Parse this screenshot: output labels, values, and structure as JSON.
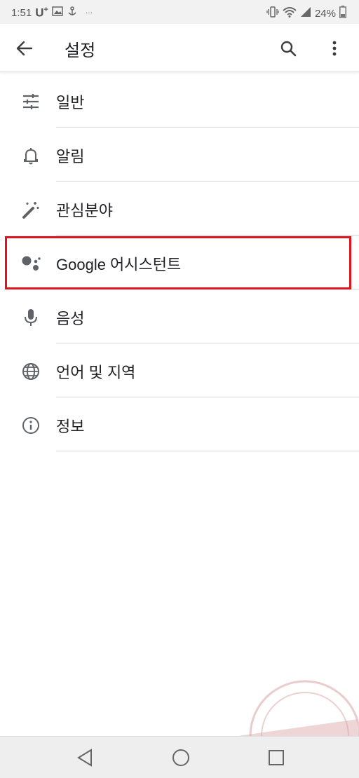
{
  "status_bar": {
    "time": "1:51",
    "carrier": "U",
    "carrier_sup": "+",
    "dots": "···",
    "battery": "24%"
  },
  "app_bar": {
    "title": "설정"
  },
  "menu": [
    {
      "label": "일반",
      "icon": "tune-sliders-icon"
    },
    {
      "label": "알림",
      "icon": "bell-icon"
    },
    {
      "label": "관심분야",
      "icon": "magic-wand-icon"
    },
    {
      "label": "Google 어시스턴트",
      "icon": "google-assistant-icon"
    },
    {
      "label": "음성",
      "icon": "microphone-icon"
    },
    {
      "label": "언어 및 지역",
      "icon": "globe-icon"
    },
    {
      "label": "정보",
      "icon": "info-icon"
    }
  ],
  "colors": {
    "highlight": "#e0141c",
    "icon": "#5f6368"
  }
}
